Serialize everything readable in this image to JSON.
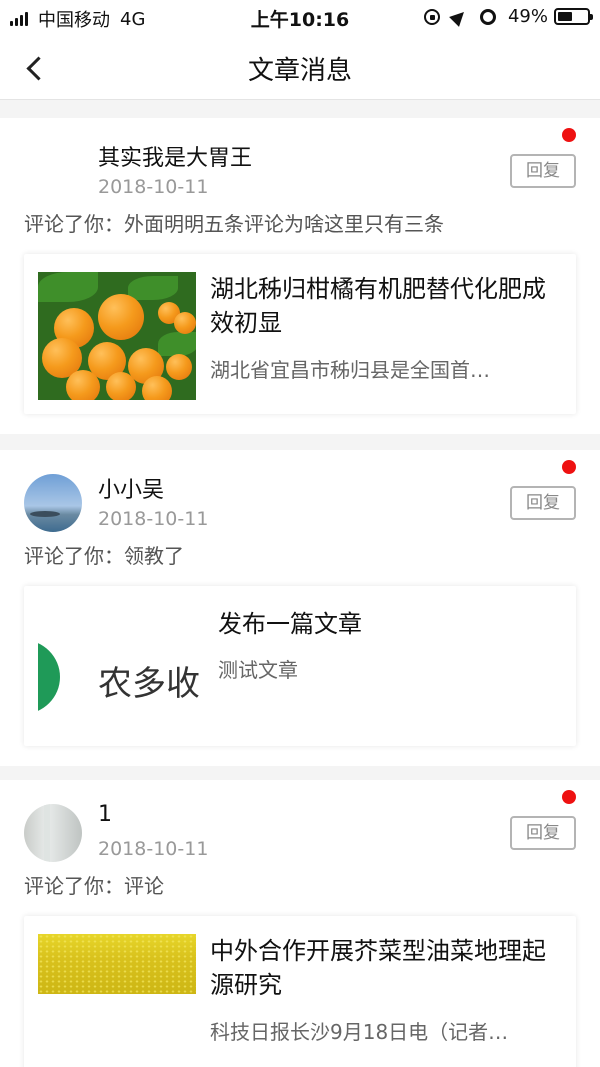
{
  "status_bar": {
    "carrier": "中国移动",
    "network": "4G",
    "time": "上午10:16",
    "battery": "49%",
    "battery_level": 0.49,
    "icons": [
      "signal-icon",
      "rotation-lock-icon",
      "location-icon",
      "alarm-icon",
      "battery-icon"
    ]
  },
  "nav": {
    "title": "文章消息",
    "back_icon": "chevron-left-icon"
  },
  "colors": {
    "unread_dot": "#ee1111",
    "logo_green": "#1f9a58",
    "background": "#f4f4f4"
  },
  "messages": [
    {
      "user": "其实我是大胃王",
      "date": "2018-10-11",
      "reply_label": "回复",
      "comment": "评论了你：外面明明五条评论为啥这里只有三条",
      "unread": true,
      "article": {
        "title": "湖北秭归柑橘有机肥替代化肥成效初显",
        "summary": "湖北省宜昌市秭归县是全国首…",
        "thumbnail": "oranges-image"
      }
    },
    {
      "user": "小小吴",
      "date": "2018-10-11",
      "reply_label": "回复",
      "comment": "评论了你：领教了",
      "unread": true,
      "article": {
        "title": "发布一篇文章",
        "summary": "测试文章",
        "logo_text": "农多收"
      }
    },
    {
      "user": "1",
      "date": "2018-10-11",
      "reply_label": "回复",
      "comment": "评论了你：评论",
      "unread": true,
      "article": {
        "title": "中外合作开展芥菜型油菜地理起源研究",
        "summary": "科技日报长沙9月18日电（记者…",
        "thumbnail": "rapeseed-field-image"
      }
    }
  ]
}
